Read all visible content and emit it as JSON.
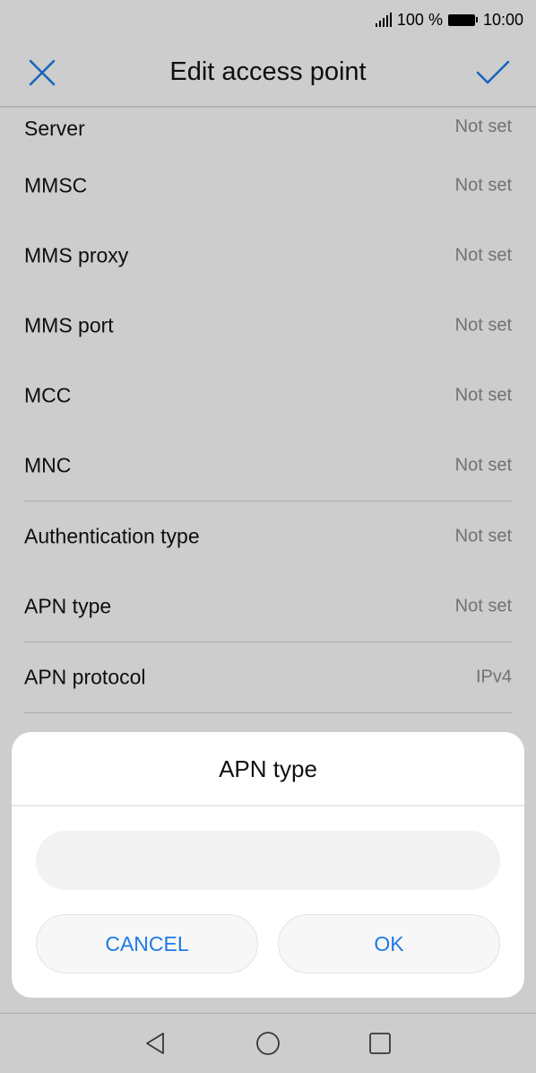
{
  "status_bar": {
    "battery_text": "100 %",
    "time": "10:00"
  },
  "header": {
    "title": "Edit access point",
    "close_icon": "close-icon",
    "confirm_icon": "check-icon"
  },
  "settings": [
    {
      "label": "Server",
      "value": "Not set"
    },
    {
      "label": "MMSC",
      "value": "Not set"
    },
    {
      "label": "MMS proxy",
      "value": "Not set"
    },
    {
      "label": "MMS port",
      "value": "Not set"
    },
    {
      "label": "MCC",
      "value": "Not set"
    },
    {
      "label": "MNC",
      "value": "Not set"
    },
    {
      "label": "Authentication type",
      "value": "Not set"
    },
    {
      "label": "APN type",
      "value": "Not set"
    },
    {
      "label": "APN protocol",
      "value": "IPv4"
    }
  ],
  "dialog": {
    "title": "APN type",
    "input_value": "",
    "cancel_label": "CANCEL",
    "ok_label": "OK"
  },
  "colors": {
    "accent": "#1e7ae5",
    "secondary_text": "#8a8a8a"
  }
}
